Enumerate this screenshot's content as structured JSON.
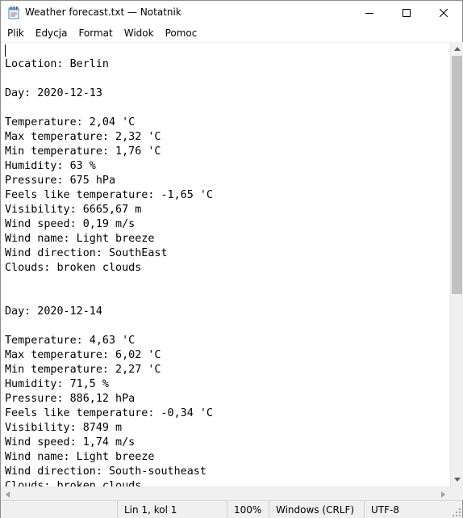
{
  "window": {
    "title": "Weather forecast.txt — Notatnik",
    "icons": {
      "app": "notepad-icon",
      "minimize": "minimize-icon",
      "maximize": "maximize-icon",
      "close": "close-icon"
    }
  },
  "menu": [
    "Plik",
    "Edycja",
    "Format",
    "Widok",
    "Pomoc"
  ],
  "content": {
    "lines": [
      "Location: Berlin",
      "",
      "Day: 2020-12-13",
      "",
      "Temperature: 2,04 'C",
      "Max temperature: 2,32 'C",
      "Min temperature: 1,76 'C",
      "Humidity: 63 %",
      "Pressure: 675 hPa",
      "Feels like temperature: -1,65 'C",
      "Visibility: 6665,67 m",
      "Wind speed: 0,19 m/s",
      "Wind name: Light breeze",
      "Wind direction: SouthEast",
      "Clouds: broken clouds",
      "",
      "",
      "Day: 2020-12-14",
      "",
      "Temperature: 4,63 'C",
      "Max temperature: 6,02 'C",
      "Min temperature: 2,27 'C",
      "Humidity: 71,5 %",
      "Pressure: 886,12 hPa",
      "Feels like temperature: -0,34 'C",
      "Visibility: 8749 m",
      "Wind speed: 1,74 m/s",
      "Wind name: Light breeze",
      "Wind direction: South-southeast",
      "Clouds: broken clouds"
    ]
  },
  "status": {
    "position": "Lin 1, kol 1",
    "zoom": "100%",
    "line_endings": "Windows (CRLF)",
    "encoding": "UTF-8"
  }
}
